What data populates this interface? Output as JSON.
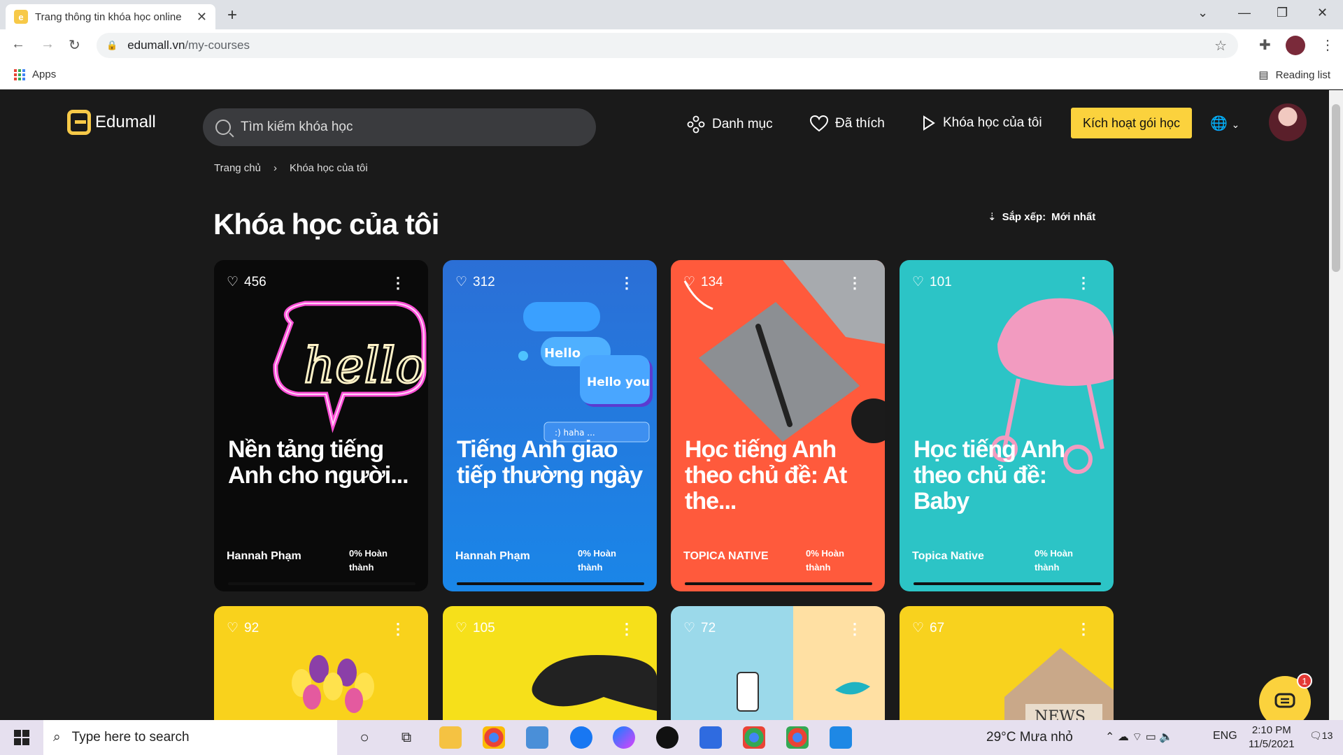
{
  "browser": {
    "tab_title": "Trang thông tin khóa học online",
    "url_host": "edumall.vn",
    "url_path": "/my-courses",
    "bookmark_apps": "Apps",
    "reading_list": "Reading list"
  },
  "header": {
    "logo_text": "Edumall",
    "search_placeholder": "Tìm kiếm khóa học",
    "nav": {
      "categories": "Danh mục",
      "liked": "Đã thích",
      "my_courses": "Khóa học của tôi"
    },
    "activate_button": "Kích hoạt gói học"
  },
  "breadcrumb": {
    "home": "Trang chủ",
    "current": "Khóa học của tôi"
  },
  "page": {
    "title": "Khóa học của tôi",
    "sort_label": "Sắp xếp:",
    "sort_value": "Mới nhất"
  },
  "courses": [
    {
      "likes": "456",
      "title": "Nền tảng tiếng Anh cho người...",
      "author": "Hannah Phạm",
      "progress": "0% Hoàn thành",
      "bg": "#0a0a0a",
      "accent": "#ff4fd8"
    },
    {
      "likes": "312",
      "title": "Tiếng Anh giao tiếp thường ngày",
      "author": "Hannah Phạm",
      "progress": "0% Hoàn thành",
      "bg": "#1677e0",
      "accent": "#3aa0ff",
      "art_text": [
        "Hello",
        "Hello you",
        ":) haha ..."
      ]
    },
    {
      "likes": "134",
      "title": "Học tiếng Anh theo chủ đề: At the...",
      "author": "TOPICA NATIVE",
      "progress": "0% Hoàn thành",
      "bg": "#ff5a3c",
      "accent": "#8c8f93"
    },
    {
      "likes": "101",
      "title": "Học tiếng Anh theo chủ đề: Baby",
      "author": "Topica Native",
      "progress": "0% Hoàn thành",
      "bg": "#2cc4c6",
      "accent": "#f29bc0"
    },
    {
      "likes": "92",
      "bg": "#f9d21c",
      "accent": "#8b3fa8"
    },
    {
      "likes": "105",
      "bg": "#f6e01a",
      "accent": "#222222"
    },
    {
      "likes": "72",
      "bg": "#9bd9ea",
      "accent": "#ffe0a3"
    },
    {
      "likes": "67",
      "bg": "#f8d21e",
      "accent": "#c9a889",
      "art_text": [
        "NEWS"
      ]
    }
  ],
  "chat_badge": "1",
  "taskbar": {
    "search_placeholder": "Type here to search",
    "weather": "29°C  Mưa nhỏ",
    "lang": "ENG",
    "time": "2:10 PM",
    "date": "11/5/2021",
    "notif_count": "13"
  }
}
